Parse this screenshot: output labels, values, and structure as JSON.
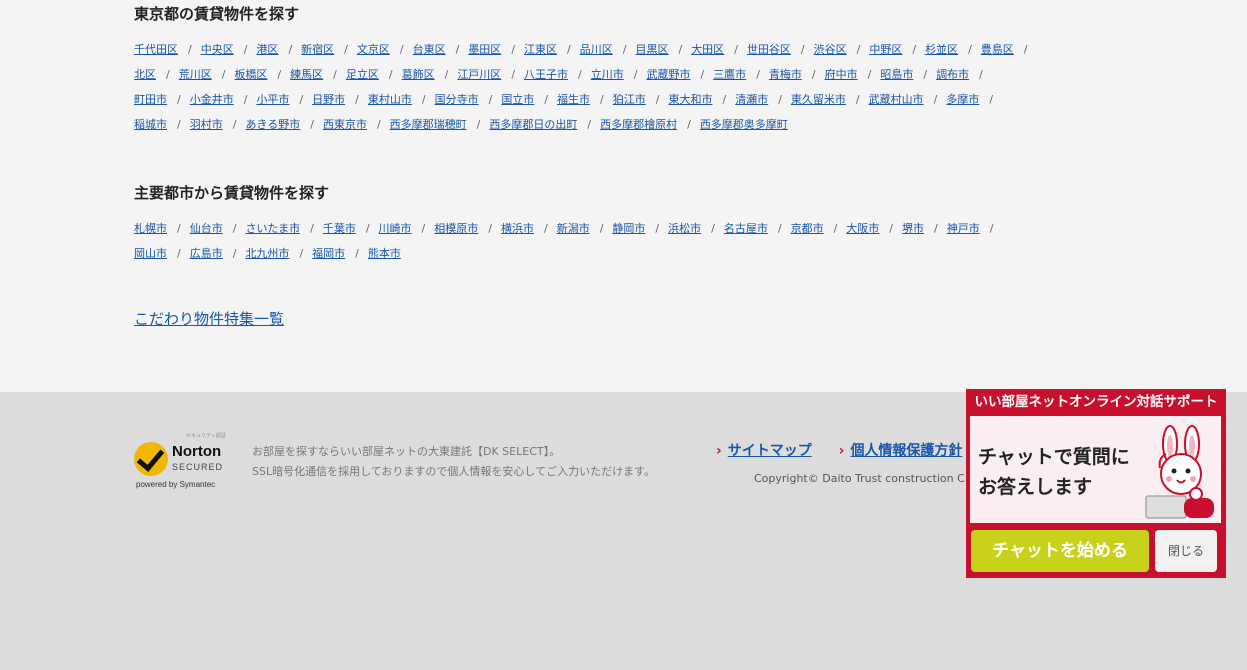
{
  "tokyo": {
    "title": "東京都の賃貸物件を探す",
    "rows": [
      [
        "千代田区",
        "中央区",
        "港区",
        "新宿区",
        "文京区",
        "台東区",
        "墨田区",
        "江東区",
        "品川区",
        "目黒区",
        "大田区",
        "世田谷区",
        "渋谷区",
        "中野区",
        "杉並区",
        "豊島区"
      ],
      [
        "北区",
        "荒川区",
        "板橋区",
        "練馬区",
        "足立区",
        "葛飾区",
        "江戸川区",
        "八王子市",
        "立川市",
        "武蔵野市",
        "三鷹市",
        "青梅市",
        "府中市",
        "昭島市",
        "調布市"
      ],
      [
        "町田市",
        "小金井市",
        "小平市",
        "日野市",
        "東村山市",
        "国分寺市",
        "国立市",
        "福生市",
        "狛江市",
        "東大和市",
        "清瀬市",
        "東久留米市",
        "武蔵村山市",
        "多摩市"
      ],
      [
        "稲城市",
        "羽村市",
        "あきる野市",
        "西東京市",
        "西多摩郡瑞穂町",
        "西多摩郡日の出町",
        "西多摩郡檜原村",
        "西多摩郡奥多摩町"
      ]
    ]
  },
  "cities": {
    "title": "主要都市から賃貸物件を探す",
    "rows": [
      [
        "札幌市",
        "仙台市",
        "さいたま市",
        "千葉市",
        "川崎市",
        "相模原市",
        "横浜市",
        "新潟市",
        "静岡市",
        "浜松市",
        "名古屋市",
        "京都市",
        "大阪市",
        "堺市",
        "神戸市"
      ],
      [
        "岡山市",
        "広島市",
        "北九州市",
        "福岡市",
        "熊本市"
      ]
    ]
  },
  "separator": "/",
  "feature_link": "こだわり物件特集一覧",
  "footer": {
    "norton_small": "セキュリティ認証",
    "norton_word": "Norton",
    "norton_secured": "SECURED",
    "norton_powered": "powered by Symantec",
    "ssl_line1": "お部屋を探すならいい部屋ネットの大東建託【DK SELECT】。",
    "ssl_line2": "SSL暗号化通信を採用しておりますので個人情報を安心してご入力いただけます。",
    "sitemap": "サイトマップ",
    "privacy": "個人情報保護方針",
    "copyright": "Copyright© Daito Trust construction C"
  },
  "chat": {
    "header": "いい部屋ネットオンライン対話サポート",
    "message_line1": "チャットで質問に",
    "message_line2": "お答えします",
    "start_button": "チャットを始める",
    "close_button": "閉じる",
    "accent_color": "#c8102e",
    "start_color": "#c9d21a"
  }
}
